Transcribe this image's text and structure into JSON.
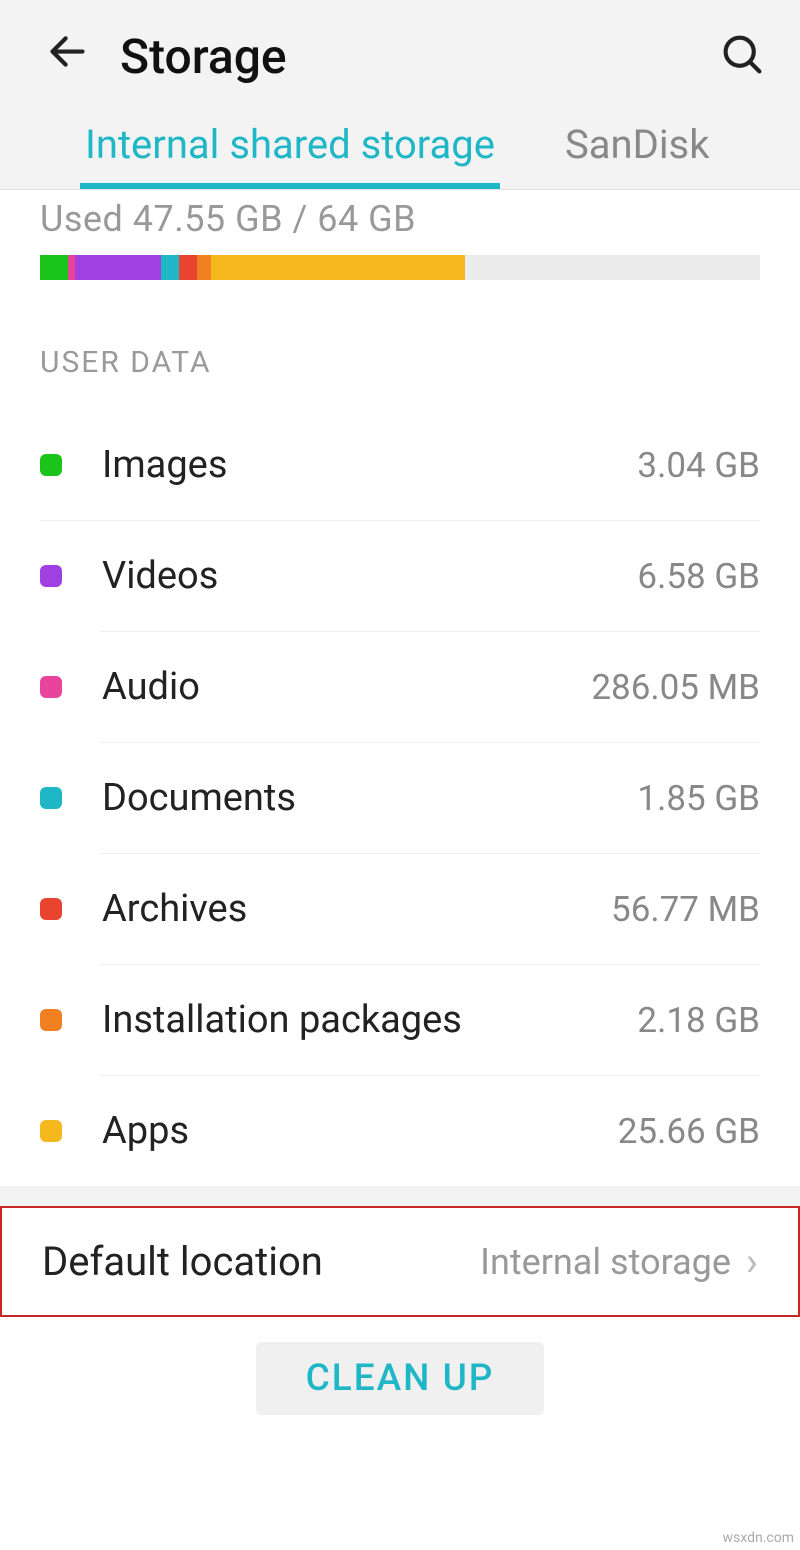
{
  "header": {
    "title": "Storage"
  },
  "tabs": {
    "internal": "Internal shared storage",
    "sandisk": "SanDisk"
  },
  "usage": {
    "text": "Used 47.55 GB / 64 GB"
  },
  "section": {
    "user_data": "USER DATA"
  },
  "rows": {
    "images": {
      "label": "Images",
      "value": "3.04 GB"
    },
    "videos": {
      "label": "Videos",
      "value": "6.58 GB"
    },
    "audio": {
      "label": "Audio",
      "value": "286.05 MB"
    },
    "documents": {
      "label": "Documents",
      "value": "1.85 GB"
    },
    "archives": {
      "label": "Archives",
      "value": "56.77 MB"
    },
    "packages": {
      "label": "Installation packages",
      "value": "2.18 GB"
    },
    "apps": {
      "label": "Apps",
      "value": "25.66 GB"
    }
  },
  "default_location": {
    "label": "Default location",
    "value": "Internal storage"
  },
  "cleanup": {
    "label": "CLEAN UP"
  },
  "watermark": "wsxdn.com"
}
